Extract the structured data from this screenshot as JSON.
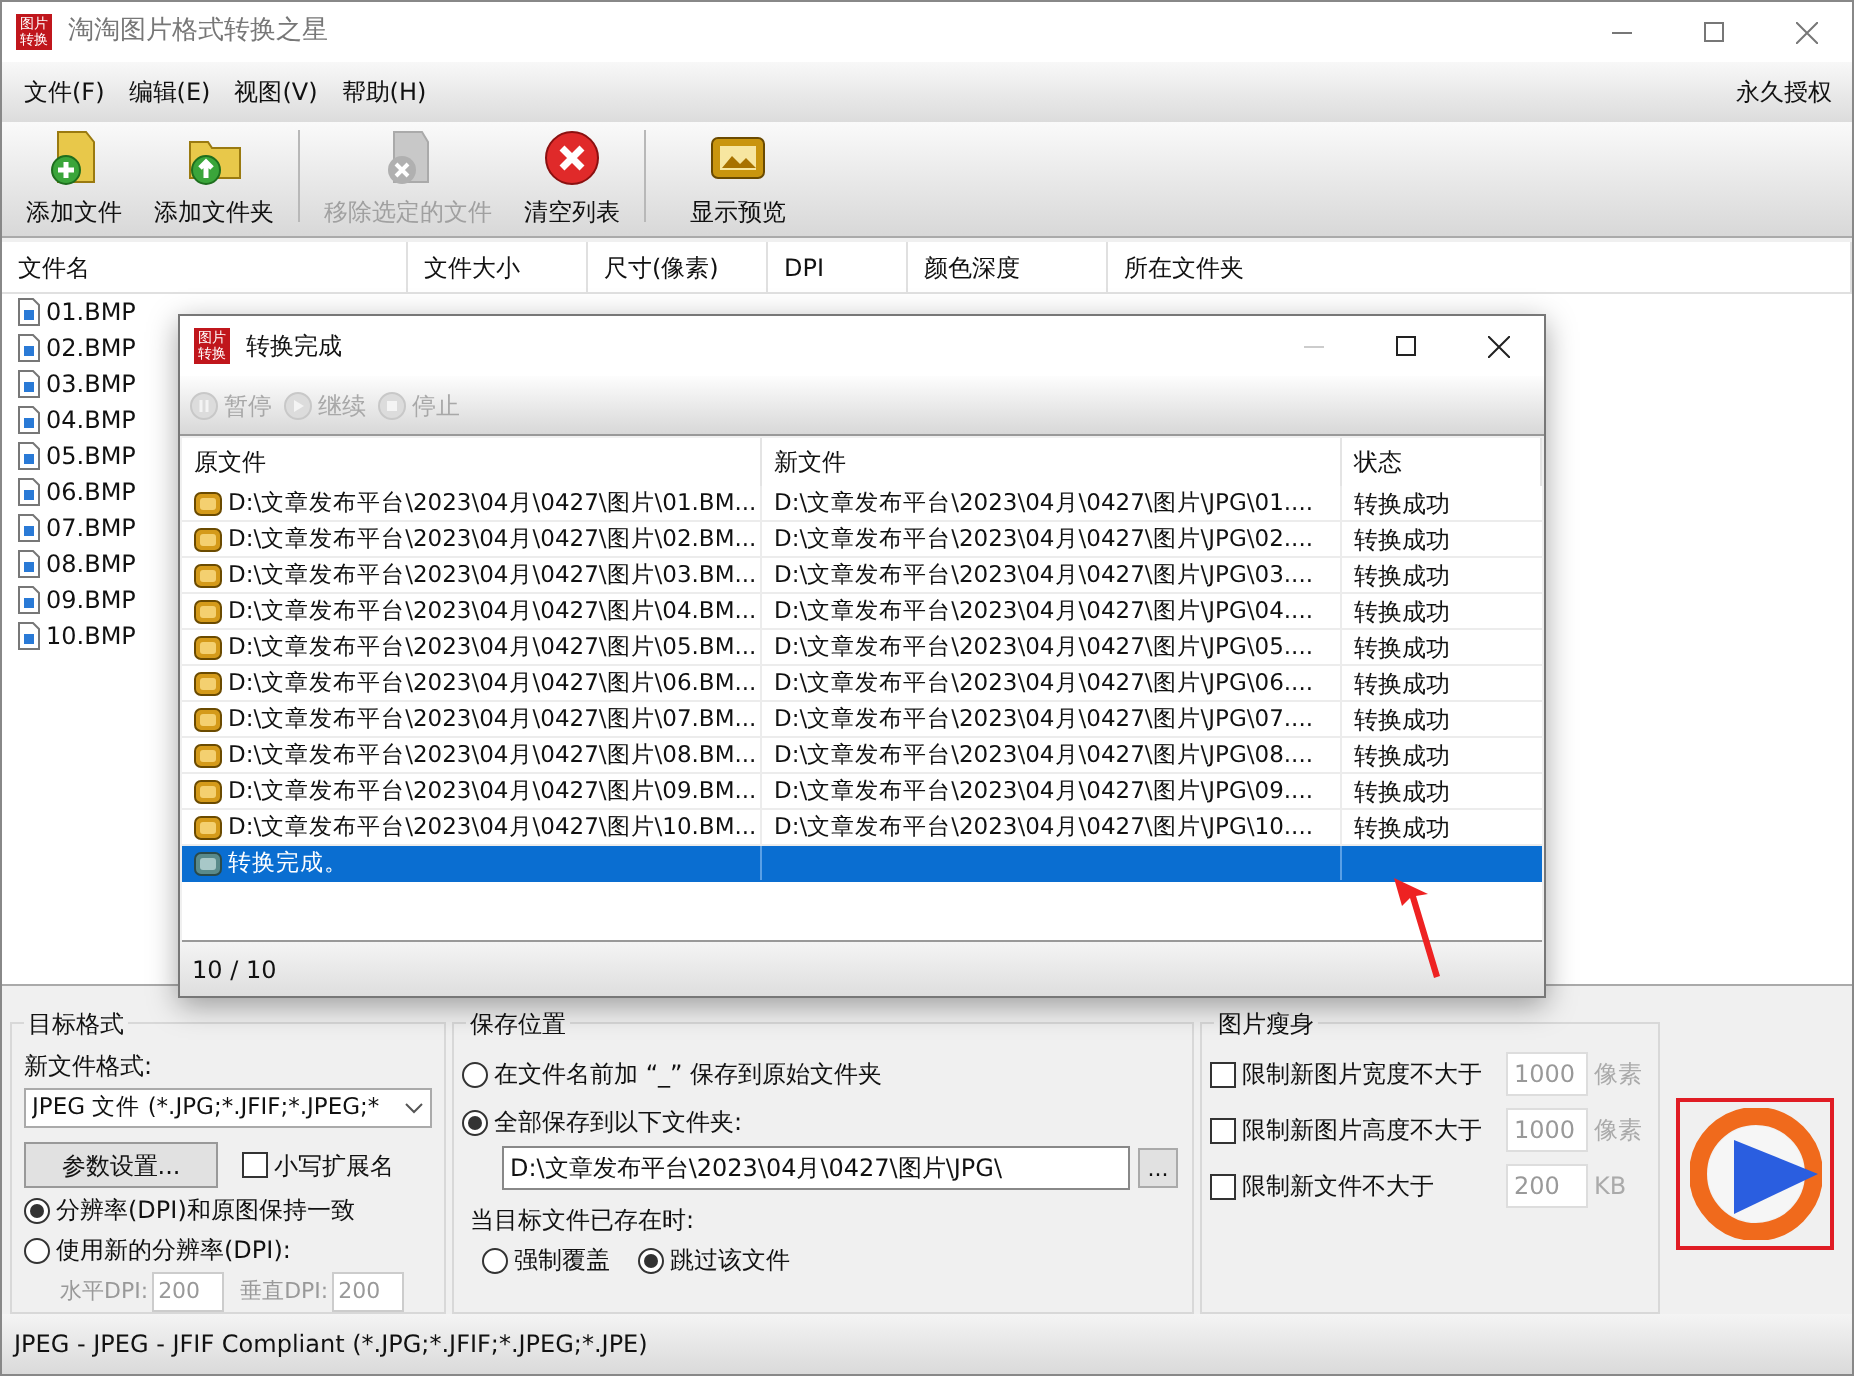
{
  "window": {
    "title": "淘淘图片格式转换之星",
    "logo": [
      "图片",
      "转换"
    ]
  },
  "menu": [
    {
      "label": "文件(F)"
    },
    {
      "label": "编辑(E)"
    },
    {
      "label": "视图(V)"
    },
    {
      "label": "帮助(H)"
    }
  ],
  "license": "永久授权",
  "toolbar": [
    {
      "label": "添加文件",
      "kind": "add-file",
      "disabled": false
    },
    {
      "label": "添加文件夹",
      "kind": "add-folder",
      "disabled": false
    },
    {
      "label": "移除选定的文件",
      "kind": "remove",
      "disabled": true
    },
    {
      "label": "清空列表",
      "kind": "clear",
      "disabled": false
    },
    {
      "label": "显示预览",
      "kind": "preview",
      "disabled": false
    }
  ],
  "file_list": {
    "columns": [
      "文件名",
      "文件大小",
      "尺寸(像素)",
      "DPI",
      "颜色深度",
      "所在文件夹"
    ],
    "rows": [
      {
        "cells": [
          "01.BMP"
        ]
      },
      {
        "cells": [
          "02.BMP"
        ]
      },
      {
        "cells": [
          "03.BMP"
        ]
      },
      {
        "cells": [
          "04.BMP"
        ]
      },
      {
        "cells": [
          "05.BMP"
        ]
      },
      {
        "cells": [
          "06.BMP"
        ]
      },
      {
        "cells": [
          "07.BMP"
        ]
      },
      {
        "cells": [
          "08.BMP"
        ]
      },
      {
        "cells": [
          "09.BMP"
        ]
      },
      {
        "cells": [
          "10.BMP"
        ]
      }
    ]
  },
  "dialog": {
    "title": "转换完成",
    "logo": [
      "图片",
      "转换"
    ],
    "toolbar": [
      {
        "label": "暂停",
        "kind": "pause",
        "disabled": true
      },
      {
        "label": "继续",
        "kind": "resume",
        "disabled": true
      },
      {
        "label": "停止",
        "kind": "stop",
        "disabled": true
      }
    ],
    "columns": [
      "原文件",
      "新文件",
      "状态"
    ],
    "rows": [
      {
        "kind": "file",
        "selected": false,
        "source": "D:\\文章发布平台\\2023\\04月\\0427\\图片\\01.BM...",
        "target": "D:\\文章发布平台\\2023\\04月\\0427\\图片\\JPG\\01....",
        "status": "转换成功"
      },
      {
        "kind": "file",
        "selected": false,
        "source": "D:\\文章发布平台\\2023\\04月\\0427\\图片\\02.BM...",
        "target": "D:\\文章发布平台\\2023\\04月\\0427\\图片\\JPG\\02....",
        "status": "转换成功"
      },
      {
        "kind": "file",
        "selected": false,
        "source": "D:\\文章发布平台\\2023\\04月\\0427\\图片\\03.BM...",
        "target": "D:\\文章发布平台\\2023\\04月\\0427\\图片\\JPG\\03....",
        "status": "转换成功"
      },
      {
        "kind": "file",
        "selected": false,
        "source": "D:\\文章发布平台\\2023\\04月\\0427\\图片\\04.BM...",
        "target": "D:\\文章发布平台\\2023\\04月\\0427\\图片\\JPG\\04....",
        "status": "转换成功"
      },
      {
        "kind": "file",
        "selected": false,
        "source": "D:\\文章发布平台\\2023\\04月\\0427\\图片\\05.BM...",
        "target": "D:\\文章发布平台\\2023\\04月\\0427\\图片\\JPG\\05....",
        "status": "转换成功"
      },
      {
        "kind": "file",
        "selected": false,
        "source": "D:\\文章发布平台\\2023\\04月\\0427\\图片\\06.BM...",
        "target": "D:\\文章发布平台\\2023\\04月\\0427\\图片\\JPG\\06....",
        "status": "转换成功"
      },
      {
        "kind": "file",
        "selected": false,
        "source": "D:\\文章发布平台\\2023\\04月\\0427\\图片\\07.BM...",
        "target": "D:\\文章发布平台\\2023\\04月\\0427\\图片\\JPG\\07....",
        "status": "转换成功"
      },
      {
        "kind": "file",
        "selected": false,
        "source": "D:\\文章发布平台\\2023\\04月\\0427\\图片\\08.BM...",
        "target": "D:\\文章发布平台\\2023\\04月\\0427\\图片\\JPG\\08....",
        "status": "转换成功"
      },
      {
        "kind": "file",
        "selected": false,
        "source": "D:\\文章发布平台\\2023\\04月\\0427\\图片\\09.BM...",
        "target": "D:\\文章发布平台\\2023\\04月\\0427\\图片\\JPG\\09....",
        "status": "转换成功"
      },
      {
        "kind": "file",
        "selected": false,
        "source": "D:\\文章发布平台\\2023\\04月\\0427\\图片\\10.BM...",
        "target": "D:\\文章发布平台\\2023\\04月\\0427\\图片\\JPG\\10....",
        "status": "转换成功"
      },
      {
        "kind": "summary",
        "selected": true,
        "source": "转换完成。"
      }
    ],
    "progress": "10 / 10"
  },
  "target_format": {
    "title": "目标格式",
    "format_label": "新文件格式:",
    "format_value": "JPEG 文件 (*.JPG;*.JFIF;*.JPEG;*",
    "settings_button": "参数设置...",
    "lowercase": {
      "label": "小写扩展名",
      "checked": false
    },
    "dpi_options": [
      {
        "label": "分辨率(DPI)和原图保持一致",
        "selected": true
      },
      {
        "label": "使用新的分辨率(DPI):",
        "selected": false
      }
    ],
    "dpi_fields": [
      {
        "label": "水平DPI:",
        "value": "200"
      },
      {
        "label": "垂直DPI:",
        "value": "200"
      }
    ]
  },
  "save_location": {
    "title": "保存位置",
    "options": [
      {
        "label": "在文件名前加 “_” 保存到原始文件夹",
        "selected": false
      },
      {
        "label": "全部保存到以下文件夹:",
        "selected": true
      }
    ],
    "folder": "D:\\文章发布平台\\2023\\04月\\0427\\图片\\JPG\\",
    "browse_button": "...",
    "exists_label": "当目标文件已存在时:",
    "exists_options": [
      {
        "label": "强制覆盖",
        "selected": false
      },
      {
        "label": "跳过该文件",
        "selected": true
      }
    ]
  },
  "slim": {
    "title": "图片瘦身",
    "limits": [
      {
        "label": "限制新图片宽度不大于",
        "checked": false,
        "value": "1000",
        "unit": "像素"
      },
      {
        "label": "限制新图片高度不大于",
        "checked": false,
        "value": "1000",
        "unit": "像素"
      },
      {
        "label": "限制新文件不大于",
        "checked": false,
        "value": "200",
        "unit": "KB"
      }
    ]
  },
  "status_bar": "JPEG - JPEG - JFIF Compliant (*.JPG;*.JFIF;*.JPEG;*.JPE)"
}
